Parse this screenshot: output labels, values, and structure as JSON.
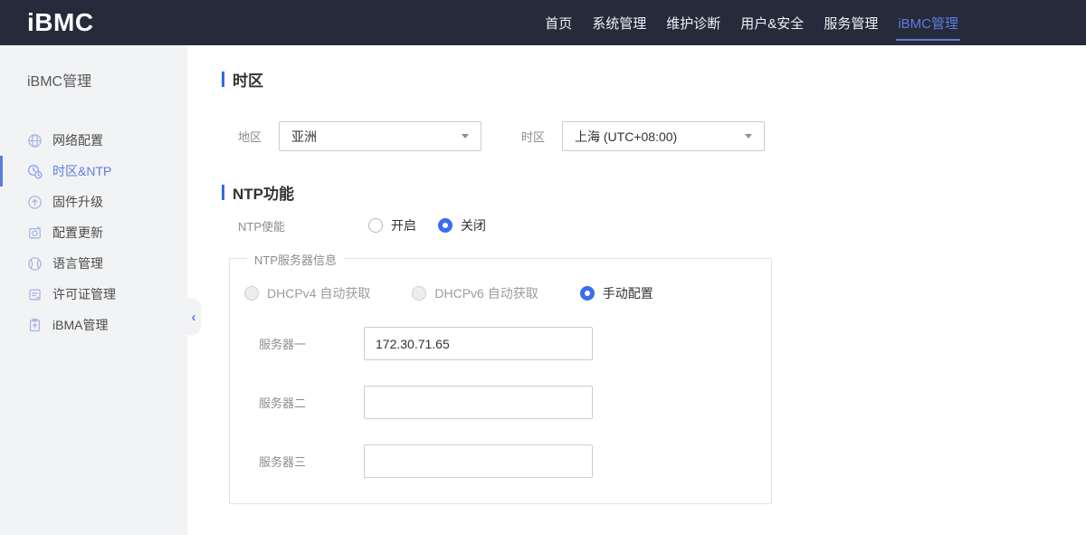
{
  "topbar": {
    "logo": "iBMC",
    "nav": [
      {
        "label": "首页",
        "active": false
      },
      {
        "label": "系统管理",
        "active": false
      },
      {
        "label": "维护诊断",
        "active": false
      },
      {
        "label": "用户&安全",
        "active": false
      },
      {
        "label": "服务管理",
        "active": false
      },
      {
        "label": "iBMC管理",
        "active": true
      }
    ]
  },
  "sidebar": {
    "title": "iBMC管理",
    "items": [
      {
        "label": "网络配置",
        "icon": "globe-icon",
        "active": false
      },
      {
        "label": "时区&NTP",
        "icon": "timezone-clock-icon",
        "active": true
      },
      {
        "label": "固件升级",
        "icon": "upgrade-arrow-icon",
        "active": false
      },
      {
        "label": "配置更新",
        "icon": "config-update-icon",
        "active": false
      },
      {
        "label": "语言管理",
        "icon": "language-globe-icon",
        "active": false
      },
      {
        "label": "许可证管理",
        "icon": "license-icon",
        "active": false
      },
      {
        "label": "iBMA管理",
        "icon": "ibma-clipboard-icon",
        "active": false
      }
    ],
    "collapse_icon": "‹"
  },
  "main": {
    "timezone_section": {
      "title": "时区",
      "region_label": "地区",
      "region_value": "亚洲",
      "timezone_label": "时区",
      "timezone_value": "上海 (UTC+08:00)"
    },
    "ntp_section": {
      "title": "NTP功能",
      "enable_label": "NTP使能",
      "enable_options": [
        {
          "label": "开启",
          "selected": false
        },
        {
          "label": "关闭",
          "selected": true
        }
      ],
      "server_group": {
        "legend": "NTP服务器信息",
        "mode_options": [
          {
            "label": "DHCPv4 自动获取",
            "selected": false,
            "disabled": true
          },
          {
            "label": "DHCPv6 自动获取",
            "selected": false,
            "disabled": true
          },
          {
            "label": "手动配置",
            "selected": true,
            "disabled": false
          }
        ],
        "servers": [
          {
            "label": "服务器一",
            "value": "172.30.71.65"
          },
          {
            "label": "服务器二",
            "value": ""
          },
          {
            "label": "服务器三",
            "value": ""
          }
        ]
      }
    }
  },
  "colors": {
    "topbar_bg": "#252b3a",
    "accent": "#5e7ce0",
    "section_bar": "#2e6bf2",
    "radio_selected": "#3a6df0",
    "sidebar_bg": "#f2f3f5"
  }
}
